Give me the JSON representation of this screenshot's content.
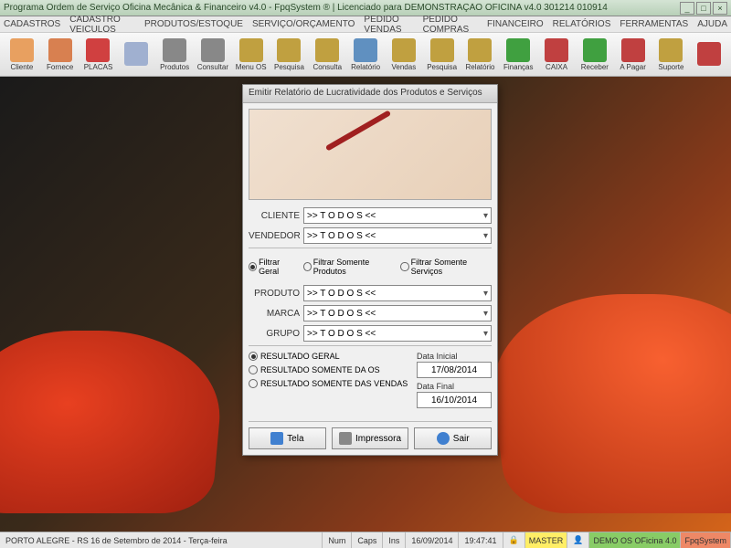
{
  "titlebar": "Programa Ordem de Serviço Oficina Mecânica & Financeiro v4.0 - FpqSystem ® | Licenciado para DEMONSTRAÇÃO OFICINA v4.0 301214 010914",
  "menu": [
    "CADASTROS",
    "CADASTRO VEICULOS",
    "PRODUTOS/ESTOQUE",
    "SERVIÇO/ORÇAMENTO",
    "PEDIDO VENDAS",
    "PEDIDO COMPRAS",
    "FINANCEIRO",
    "RELATÓRIOS",
    "FERRAMENTAS",
    "AJUDA"
  ],
  "toolbar": [
    {
      "label": "Cliente",
      "color": "#e8a060"
    },
    {
      "label": "Fornece",
      "color": "#d88050"
    },
    {
      "label": "PLACAS",
      "color": "#d04040"
    },
    {
      "label": "",
      "color": "#a0b0d0"
    },
    {
      "label": "Produtos",
      "color": "#888"
    },
    {
      "label": "Consultar",
      "color": "#888"
    },
    {
      "label": "Menu OS",
      "color": "#c0a040"
    },
    {
      "label": "Pesquisa",
      "color": "#c0a040"
    },
    {
      "label": "Consulta",
      "color": "#c0a040"
    },
    {
      "label": "Relatório",
      "color": "#6090c0"
    },
    {
      "label": "Vendas",
      "color": "#c0a040"
    },
    {
      "label": "Pesquisa",
      "color": "#c0a040"
    },
    {
      "label": "Relatório",
      "color": "#c0a040"
    },
    {
      "label": "Finanças",
      "color": "#40a040"
    },
    {
      "label": "CAIXA",
      "color": "#c04040"
    },
    {
      "label": "Receber",
      "color": "#40a040"
    },
    {
      "label": "A Pagar",
      "color": "#c04040"
    },
    {
      "label": "Suporte",
      "color": "#c0a040"
    },
    {
      "label": "",
      "color": "#c04040"
    }
  ],
  "dialog": {
    "title": "Emitir Relatório de Lucratividade dos Produtos e Serviços",
    "labels": {
      "cliente": "CLIENTE",
      "vendedor": "VENDEDOR",
      "produto": "PRODUTO",
      "marca": "MARCA",
      "grupo": "GRUPO"
    },
    "todos": ">>  T O D O S  <<",
    "filter": {
      "geral": "Filtrar Geral",
      "produtos": "Filtrar Somente Produtos",
      "servicos": "Filtrar Somente Serviços"
    },
    "result": {
      "geral": "RESULTADO GERAL",
      "os": "RESULTADO SOMENTE DA OS",
      "vendas": "RESULTADO SOMENTE DAS VENDAS"
    },
    "dates": {
      "inicial_label": "Data Inicial",
      "inicial": "17/08/2014",
      "final_label": "Data Final",
      "final": "16/10/2014"
    },
    "buttons": {
      "tela": "Tela",
      "impressora": "Impressora",
      "sair": "Sair"
    }
  },
  "status": {
    "main": "PORTO ALEGRE - RS 16 de Setembro de 2014 - Terça-feira",
    "num": "Num",
    "caps": "Caps",
    "ins": "Ins",
    "date": "16/09/2014",
    "time": "19:47:41",
    "master": "MASTER",
    "demo": "DEMO OS OFicina 4.0",
    "fpq": "FpqSystem"
  }
}
